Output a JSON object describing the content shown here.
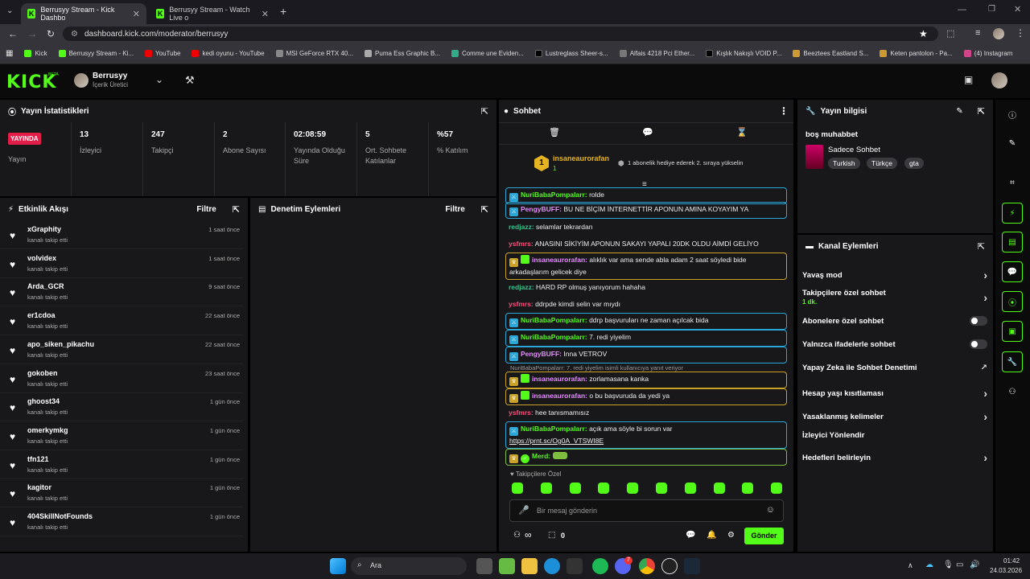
{
  "browser": {
    "tabs": [
      {
        "title": "Berrusyy Stream - Kick Dashbo"
      },
      {
        "title": "Berrusyy Stream - Watch Live o"
      }
    ],
    "url": "dashboard.kick.com/moderator/berrusyy",
    "bookmarks": [
      "Kick",
      "Berrusyy Stream - Ki...",
      "YouTube",
      "kedi oyunu - YouTube",
      "MSI GeForce RTX 40...",
      "Puma Ess Graphic B...",
      "Comme une Eviden...",
      "Lustreglass Sheer-s...",
      "Alfais 4218 Pci Ether...",
      "Kışlık Nakışlı VOID P...",
      "Beeztees Eastland S...",
      "Keten pantolon - Pa...",
      "(4) Instagram"
    ]
  },
  "header": {
    "logo": "KICK",
    "beta": "BETA",
    "user_name": "Berrusyy",
    "user_role": "İçerik Üretici"
  },
  "stats": {
    "title": "Yayın İstatistikleri",
    "live_badge": "YAYINDA",
    "live_label": "Yayın",
    "items": [
      {
        "value": "13",
        "label": "İzleyici"
      },
      {
        "value": "247",
        "label": "Takipçi"
      },
      {
        "value": "2",
        "label": "Abone Sayısı"
      },
      {
        "value": "02:08:59",
        "label": "Yayında Olduğu Süre"
      },
      {
        "value": "5",
        "label": "Ort. Sohbete Katılanlar"
      },
      {
        "value": "%57",
        "label": "% Katılım"
      }
    ]
  },
  "activity": {
    "title": "Etkinlik Akışı",
    "filter": "Filtre",
    "sub": "kanalı takip etti",
    "events": [
      {
        "name": "xGraphity",
        "time": "1 saat önce"
      },
      {
        "name": "volvidex",
        "time": "1 saat önce"
      },
      {
        "name": "Arda_GCR",
        "time": "9 saat önce"
      },
      {
        "name": "er1cdoa",
        "time": "22 saat önce"
      },
      {
        "name": "apo_siken_pikachu",
        "time": "22 saat önce"
      },
      {
        "name": "gokoben",
        "time": "23 saat önce"
      },
      {
        "name": "ghoost34",
        "time": "1 gün önce"
      },
      {
        "name": "omerkymkg",
        "time": "1 gün önce"
      },
      {
        "name": "tfn121",
        "time": "1 gün önce"
      },
      {
        "name": "kagitor",
        "time": "1 gün önce"
      },
      {
        "name": "404SkillNotFounds",
        "time": "1 gün önce"
      }
    ]
  },
  "moderation": {
    "title": "Denetim Eylemleri",
    "filter": "Filtre"
  },
  "chat": {
    "title": "Sohbet",
    "top_gifter": "insaneaurorafan",
    "top_rank": "1",
    "top_count": "1",
    "gift_prompt": "1 abonelik hediye ederek 2. sıraya yükselin",
    "messages": [
      {
        "user": "NuriBabaPompalarr",
        "text": "rolde",
        "color": "#53fc18",
        "box": "#2aa7d8"
      },
      {
        "user": "PengyBUFF",
        "text": "BU NE BİÇİM İNTERNETTİR APONUN AMINA KOYAYIM YA",
        "color": "#e58cff",
        "box": "#2aa7d8"
      },
      {
        "user": "redjazz",
        "text": "selamlar tekrardan",
        "color": "#31c48d",
        "box": ""
      },
      {
        "user": "ysfmrs",
        "text": "ANASINI SİKİYİM APONUN SAKAYI YAPALI 20DK OLDU AİMDİ GELİYO",
        "color": "#ff4d7a",
        "box": ""
      },
      {
        "user": "insaneaurorafan",
        "text": "alıklık var ama sende abla adam 2 saat söyledi bide arkadaşlarım gelicek diye",
        "color": "#e58cff",
        "box": "#c9a227"
      },
      {
        "user": "redjazz",
        "text": "HARD RP olmuş yanıyorum hahaha",
        "color": "#31c48d",
        "box": ""
      },
      {
        "user": "ysfmrs",
        "text": "ddrpde kimdi selin var mıydı",
        "color": "#ff4d7a",
        "box": ""
      },
      {
        "user": "NuriBabaPompalarr",
        "text": "ddrp başvuruları ne zaman açılcak bida",
        "color": "#53fc18",
        "box": "#2aa7d8"
      },
      {
        "user": "NuriBabaPompalarr",
        "text": "7. redi yiyelim",
        "color": "#53fc18",
        "box": "#2aa7d8"
      },
      {
        "user": "PengyBUFF",
        "text": "Inna VETROV",
        "color": "#e58cff",
        "box": "#2aa7d8"
      },
      {
        "user": "insaneaurorafan",
        "text": "zorlamasana kanka",
        "color": "#e58cff",
        "box": "#c9a227"
      },
      {
        "user": "insaneaurorafan",
        "text": "o bu başvuruda da yedi ya",
        "color": "#e58cff",
        "box": "#c9a227"
      },
      {
        "user": "ysfmrs",
        "text": "hee tanısmamısız",
        "color": "#ff4d7a",
        "box": ""
      },
      {
        "user": "NuriBabaPompalarr",
        "text": "açık ama söyle bi sorun var",
        "color": "#53fc18",
        "box": "#2aa7d8"
      },
      {
        "user": "Merd",
        "text": "",
        "color": "#53fc18",
        "box": "#7fbf3f"
      }
    ],
    "reply_note": "NuriBabaPompalarr: 7. redi yiyelim isimli kullanıcıya yanıt veriyor",
    "link": "https://prnt.sc/Og0A_VTSWI8E",
    "emote_label": "Takipçilere Özel",
    "input_placeholder": "Bir mesaj gönderin",
    "send": "Gönder",
    "points": "0",
    "infinity": "∞"
  },
  "stream_info": {
    "title": "Yayın bilgisi",
    "stream_title": "boş muhabbet",
    "category": "Sadece Sohbet",
    "tags": [
      "Turkish",
      "Türkçe",
      "gta"
    ]
  },
  "channel_actions": {
    "title": "Kanal Eylemleri",
    "slow": "Yavaş mod",
    "follower_only": "Takipçilere özel sohbet",
    "follower_dur": "1 dk.",
    "sub_only": "Abonelere özel sohbet",
    "emote_only": "Yalnızca ifadelerle sohbet",
    "ai_mod": "Yapay Zeka ile Sohbet Denetimi",
    "age": "Hesap yaşı kısıtlaması",
    "banned": "Yasaklanmış kelimeler",
    "redirect": "İzleyici Yönlendir",
    "goals": "Hedefleri belirleyin"
  },
  "taskbar": {
    "search": "Ara",
    "time": "01:42",
    "date": "24.03.2026",
    "badge": "7"
  }
}
